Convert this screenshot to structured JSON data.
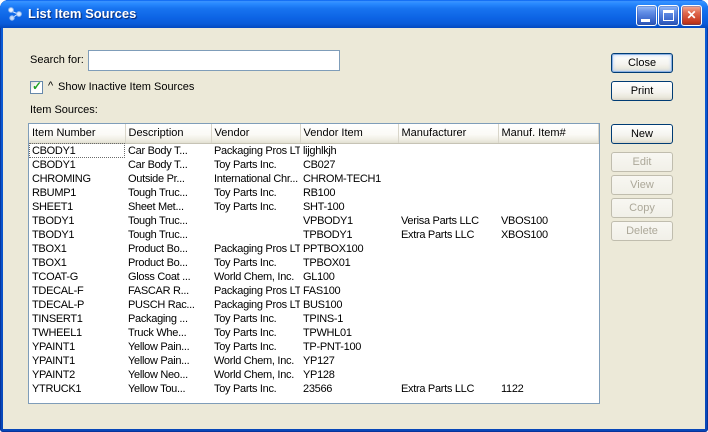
{
  "window": {
    "title": "List Item Sources"
  },
  "titlebar": {
    "close_glyph": "✕"
  },
  "search": {
    "label": "Search for:",
    "value": ""
  },
  "action_buttons": {
    "close": "Close",
    "print": "Print"
  },
  "checkbox": {
    "checked": true,
    "caret_glyph": "^",
    "label": "Show Inactive Item Sources"
  },
  "table": {
    "label": "Item Sources:",
    "headers": [
      "Item Number",
      "Description",
      "Vendor",
      "Vendor Item",
      "Manufacturer",
      "Manuf. Item#"
    ],
    "rows": [
      [
        "CBODY1",
        "Car Body T...",
        "Packaging Pros LTD",
        "lijghlkjh",
        "",
        ""
      ],
      [
        "CBODY1",
        "Car Body T...",
        "Toy Parts Inc.",
        "CB027",
        "",
        ""
      ],
      [
        "CHROMING",
        "Outside Pr...",
        "International Chr...",
        "CHROM-TECH1",
        "",
        ""
      ],
      [
        "RBUMP1",
        "Tough Truc...",
        "Toy Parts Inc.",
        "RB100",
        "",
        ""
      ],
      [
        "SHEET1",
        "Sheet Met...",
        "Toy Parts Inc.",
        "SHT-100",
        "",
        ""
      ],
      [
        "TBODY1",
        "Tough Truc...",
        "",
        "VPBODY1",
        "Verisa Parts LLC",
        "VBOS100"
      ],
      [
        "TBODY1",
        "Tough Truc...",
        "",
        "TPBODY1",
        "Extra Parts LLC",
        "XBOS100"
      ],
      [
        "TBOX1",
        "Product Bo...",
        "Packaging Pros LTD",
        "PPTBOX100",
        "",
        ""
      ],
      [
        "TBOX1",
        "Product Bo...",
        "Toy Parts Inc.",
        "TPBOX01",
        "",
        ""
      ],
      [
        "TCOAT-G",
        "Gloss Coat ...",
        "World Chem, Inc.",
        "GL100",
        "",
        ""
      ],
      [
        "TDECAL-F",
        "FASCAR R...",
        "Packaging Pros LTD",
        "FAS100",
        "",
        ""
      ],
      [
        "TDECAL-P",
        "PUSCH Rac...",
        "Packaging Pros LTD",
        "BUS100",
        "",
        ""
      ],
      [
        "TINSERT1",
        "Packaging ...",
        "Toy Parts Inc.",
        "TPINS-1",
        "",
        ""
      ],
      [
        "TWHEEL1",
        "Truck Whe...",
        "Toy Parts Inc.",
        "TPWHL01",
        "",
        ""
      ],
      [
        "YPAINT1",
        "Yellow Pain...",
        "Toy Parts Inc.",
        "TP-PNT-100",
        "",
        ""
      ],
      [
        "YPAINT1",
        "Yellow Pain...",
        "World Chem, Inc.",
        "YP127",
        "",
        ""
      ],
      [
        "YPAINT2",
        "Yellow Neo...",
        "World Chem, Inc.",
        "YP128",
        "",
        ""
      ],
      [
        "YTRUCK1",
        "Yellow Tou...",
        "Toy Parts Inc.",
        "23566",
        "Extra Parts LLC",
        "1122"
      ]
    ]
  },
  "side_buttons": [
    {
      "label": "New",
      "enabled": true
    },
    {
      "label": "Edit",
      "enabled": false
    },
    {
      "label": "View",
      "enabled": false
    },
    {
      "label": "Copy",
      "enabled": false
    },
    {
      "label": "Delete",
      "enabled": false
    }
  ],
  "colors": {
    "titlebar_blue": "#0A5CD6",
    "window_bg": "#ECE9D8",
    "button_border": "#003C74",
    "check_green": "#21A121",
    "close_red": "#C83C22"
  }
}
